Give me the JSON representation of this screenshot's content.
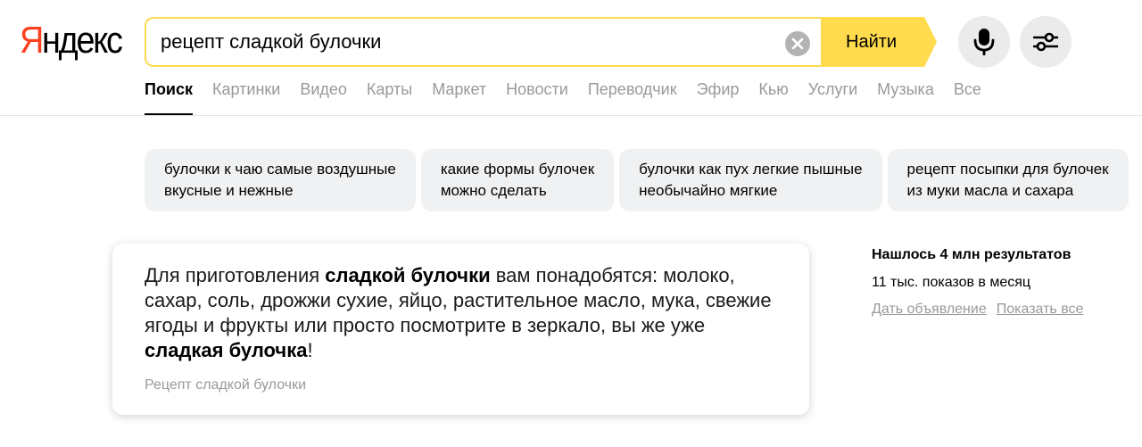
{
  "logo": {
    "first_letter": "Я",
    "rest": "ндекс"
  },
  "search": {
    "query": "рецепт сладкой булочки",
    "button_label": "Найти"
  },
  "tabs": [
    "Поиск",
    "Картинки",
    "Видео",
    "Карты",
    "Маркет",
    "Новости",
    "Переводчик",
    "Эфир",
    "Кью",
    "Услуги",
    "Музыка",
    "Все"
  ],
  "suggestions": [
    {
      "line1": "булочки к чаю самые воздушные",
      "line2": "вкусные и нежные"
    },
    {
      "line1": "какие формы булочек",
      "line2": "можно сделать"
    },
    {
      "line1": "булочки как пух легкие пышные",
      "line2": "необычайно мягкие"
    },
    {
      "line1": "рецепт посыпки для булочек",
      "line2": "из муки масла и сахара"
    }
  ],
  "answer": {
    "p1": "Для приготовления ",
    "b1": "сладкой булочки",
    "p2": " вам понадобятся: молоко, сахар, соль, дрожжи сухие, яйцо, растительное масло, мука, свежие ягоды и фрукты или просто посмотрите в зеркало, вы же уже ",
    "b2": "сладкая булочка",
    "p3": "!",
    "source": "Рецепт сладкой булочки"
  },
  "stats": {
    "title": "Нашлось 4 млн результатов",
    "impressions": "11 тыс. показов в месяц",
    "link_ad": "Дать объявление",
    "link_all": "Показать все"
  },
  "colors": {
    "brand_red": "#fc3f1d",
    "accent_yellow": "#ffdb4d"
  }
}
